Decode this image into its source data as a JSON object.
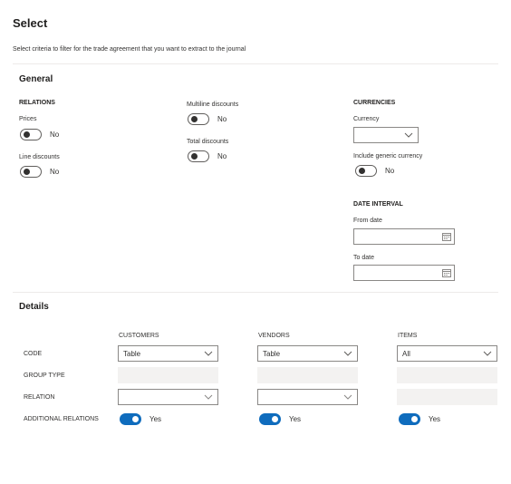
{
  "page": {
    "title": "Select",
    "subtitle": "Select criteria to filter for the trade agreement that you want to extract to the journal"
  },
  "general": {
    "heading": "General",
    "relations": {
      "heading": "RELATIONS",
      "prices": {
        "label": "Prices",
        "value": "No",
        "on": false
      },
      "line_discounts": {
        "label": "Line discounts",
        "value": "No",
        "on": false
      },
      "multiline_discounts": {
        "label": "Multiline discounts",
        "value": "No",
        "on": false
      },
      "total_discounts": {
        "label": "Total discounts",
        "value": "No",
        "on": false
      }
    },
    "currencies": {
      "heading": "CURRENCIES",
      "currency": {
        "label": "Currency",
        "value": ""
      },
      "include_generic": {
        "label": "Include generic currency",
        "value": "No",
        "on": false
      }
    },
    "date_interval": {
      "heading": "DATE INTERVAL",
      "from_date": {
        "label": "From date",
        "value": ""
      },
      "to_date": {
        "label": "To date",
        "value": ""
      }
    }
  },
  "details": {
    "heading": "Details",
    "columns": [
      "CUSTOMERS",
      "VENDORS",
      "ITEMS"
    ],
    "rows": {
      "code": {
        "label": "CODE",
        "values": [
          "Table",
          "Table",
          "All"
        ]
      },
      "group_type": {
        "label": "GROUP TYPE"
      },
      "relation": {
        "label": "RELATION",
        "values": [
          "",
          ""
        ]
      },
      "additional_relations": {
        "label": "ADDITIONAL RELATIONS",
        "values": [
          "Yes",
          "Yes",
          "Yes"
        ]
      }
    }
  },
  "colors": {
    "accent": "#0f6cbd",
    "border": "#8a8886",
    "disabled": "#f3f2f1"
  },
  "icons": {
    "dropdown": "chevron-down-icon",
    "calendar": "calendar-icon"
  }
}
